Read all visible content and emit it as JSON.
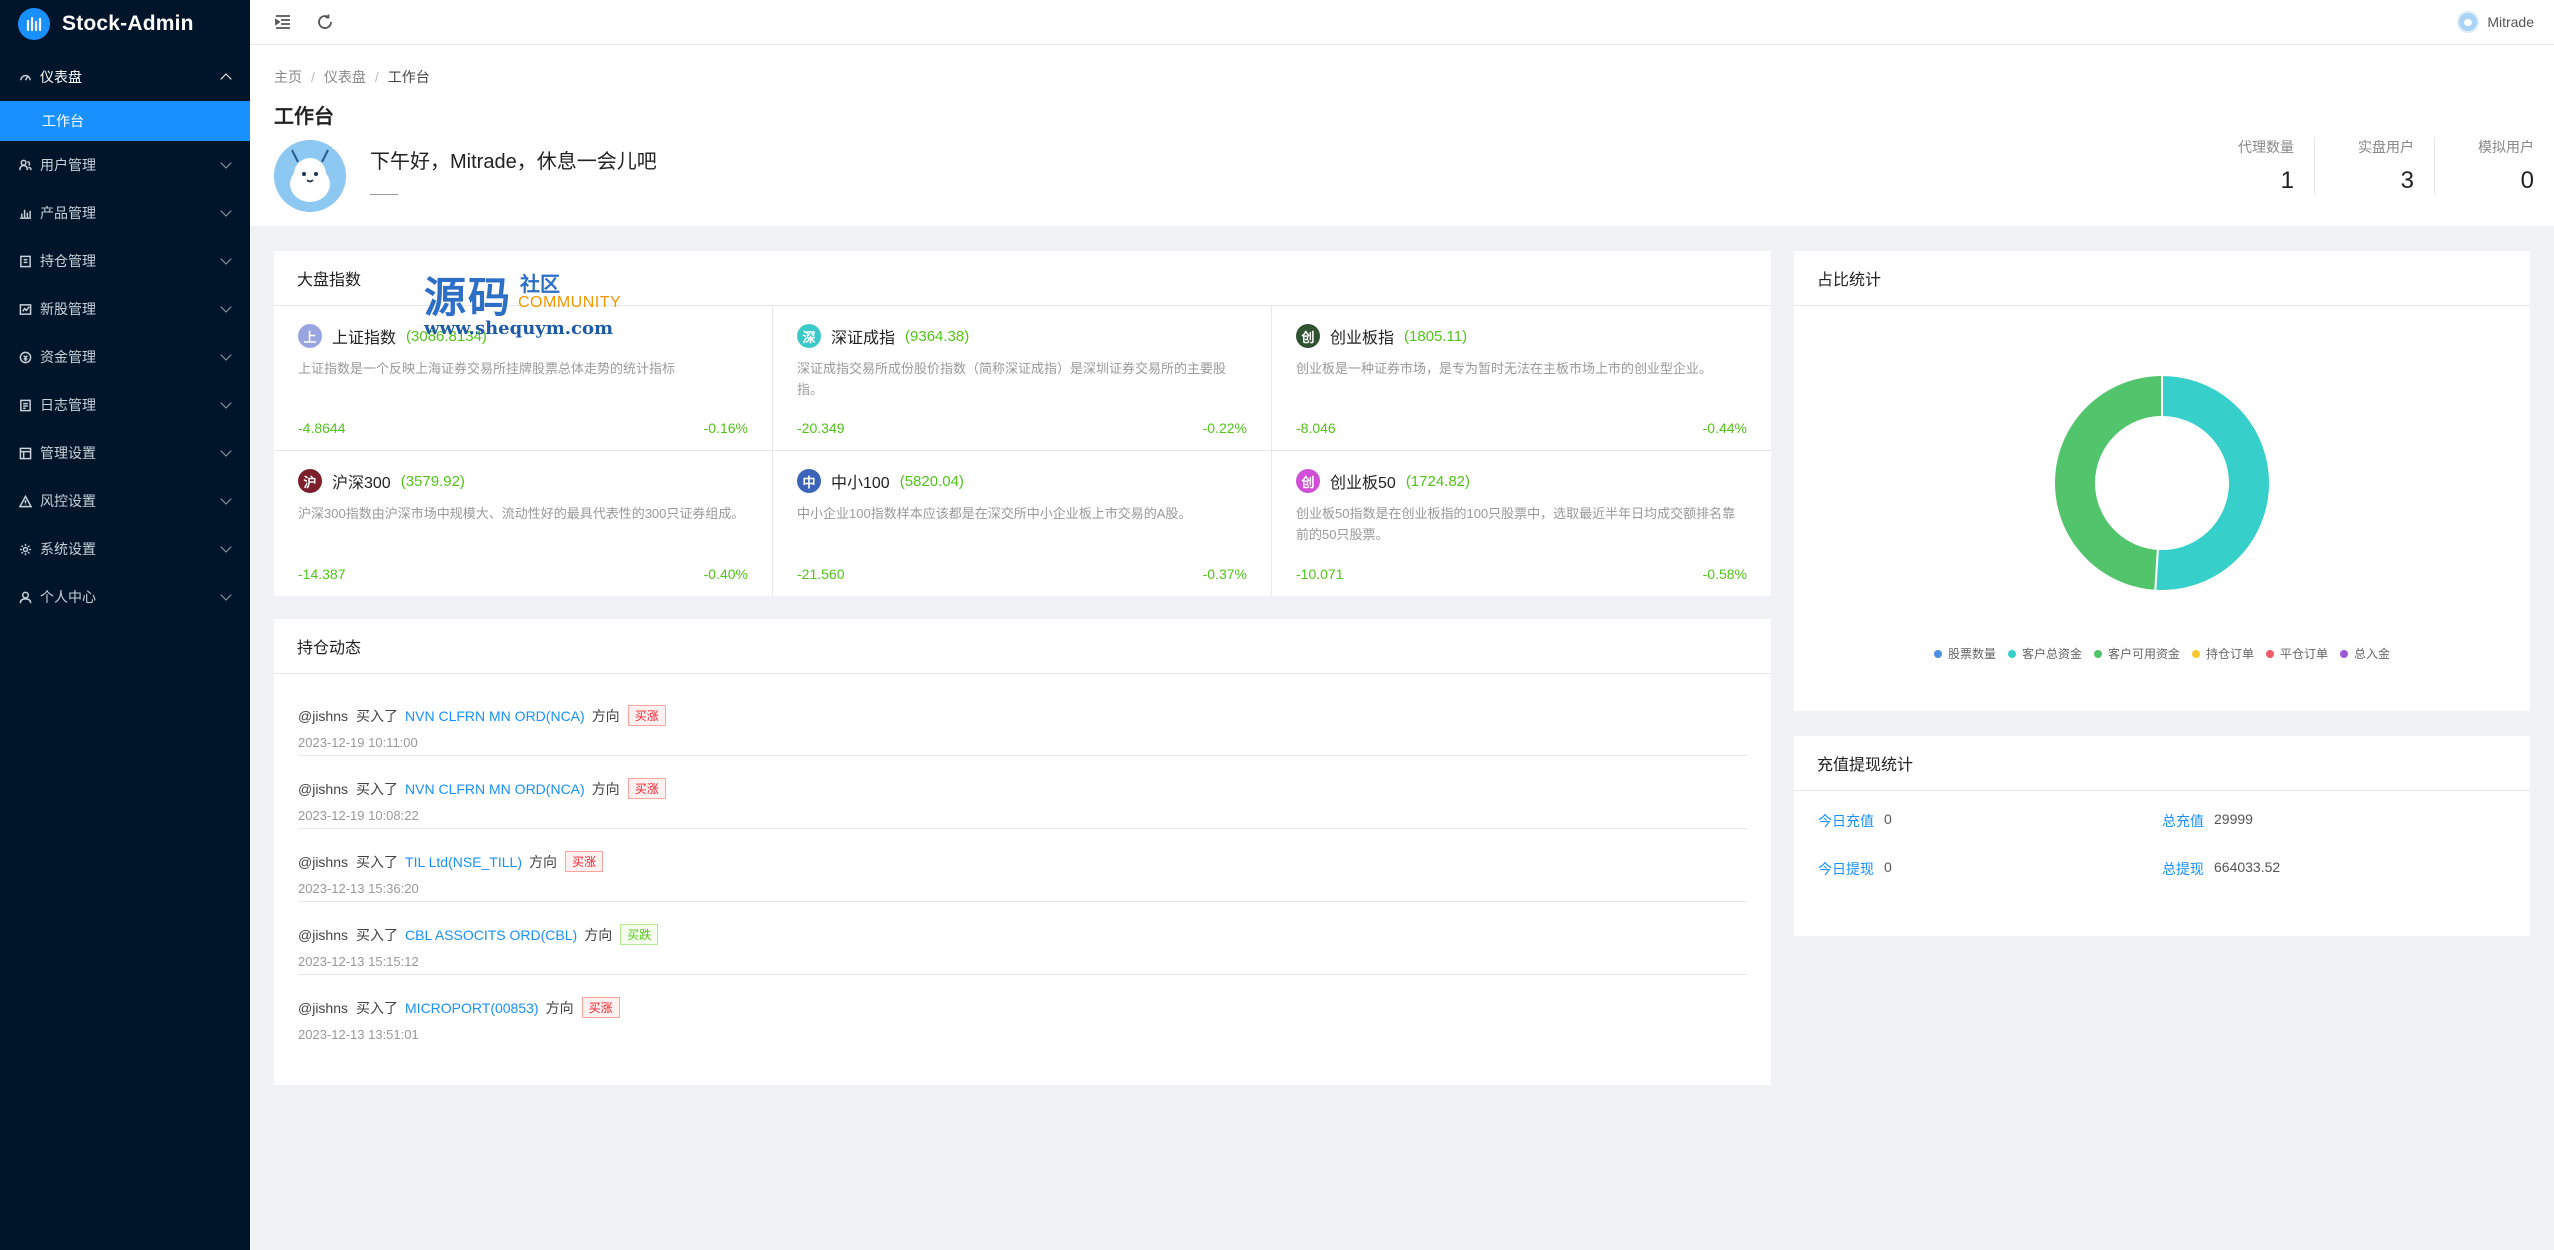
{
  "app": {
    "title": "Stock-Admin"
  },
  "sidebar": {
    "items": [
      {
        "label": "仪表盘",
        "icon": "dashboard-icon",
        "open": true
      },
      {
        "label": "用户管理",
        "icon": "users-icon"
      },
      {
        "label": "产品管理",
        "icon": "bar-chart-icon"
      },
      {
        "label": "持仓管理",
        "icon": "position-icon"
      },
      {
        "label": "新股管理",
        "icon": "new-stock-icon"
      },
      {
        "label": "资金管理",
        "icon": "money-icon"
      },
      {
        "label": "日志管理",
        "icon": "log-icon"
      },
      {
        "label": "管理设置",
        "icon": "admin-settings-icon"
      },
      {
        "label": "风控设置",
        "icon": "warning-icon"
      },
      {
        "label": "系统设置",
        "icon": "gear-icon"
      },
      {
        "label": "个人中心",
        "icon": "user-icon"
      }
    ],
    "active_sub": "工作台"
  },
  "header": {
    "user_name": "Mitrade"
  },
  "breadcrumb": [
    "主页",
    "仪表盘",
    "工作台"
  ],
  "page": {
    "title": "工作台",
    "greeting": "下午好，Mitrade，休息一会儿吧"
  },
  "stats": [
    {
      "label": "代理数量",
      "value": "1"
    },
    {
      "label": "实盘用户",
      "value": "3"
    },
    {
      "label": "模拟用户",
      "value": "0"
    }
  ],
  "market": {
    "title": "大盘指数",
    "indices": [
      {
        "badge": "上",
        "color": "#9aa4e0",
        "name": "上证指数",
        "value": "(3086.8134)",
        "desc": "上证指数是一个反映上海证券交易所挂牌股票总体走势的统计指标",
        "change": "-4.8644",
        "pct": "-0.16%"
      },
      {
        "badge": "深",
        "color": "#3ec9c9",
        "name": "深证成指",
        "value": "(9364.38)",
        "desc": "深证成指交易所成份股价指数（简称深证成指）是深圳证券交易所的主要股指。",
        "change": "-20.349",
        "pct": "-0.22%"
      },
      {
        "badge": "创",
        "color": "#2f5233",
        "name": "创业板指",
        "value": "(1805.11)",
        "desc": "创业板是一种证券市场，是专为暂时无法在主板市场上市的创业型企业。",
        "change": "-8.046",
        "pct": "-0.44%"
      },
      {
        "badge": "沪",
        "color": "#7a1f2b",
        "name": "沪深300",
        "value": "(3579.92)",
        "desc": "沪深300指数由沪深市场中规模大、流动性好的最具代表性的300只证券组成。",
        "change": "-14.387",
        "pct": "-0.40%"
      },
      {
        "badge": "中",
        "color": "#3b63b7",
        "name": "中小100",
        "value": "(5820.04)",
        "desc": "中小企业100指数样本应该都是在深交所中小企业板上市交易的A股。",
        "change": "-21.560",
        "pct": "-0.37%"
      },
      {
        "badge": "创",
        "color": "#d04fd6",
        "name": "创业板50",
        "value": "(1724.82)",
        "desc": "创业板50指数是在创业板指的100只股票中，选取最近半年日均成交额排名靠前的50只股票。",
        "change": "-10.071",
        "pct": "-0.58%"
      }
    ]
  },
  "watermark": {
    "big": "源码",
    "sq": "社区",
    "community": "COMMUNITY",
    "url": "www.shequym.com"
  },
  "positions": {
    "title": "持仓动态",
    "items": [
      {
        "user": "@jishns",
        "action": "买入了",
        "stock": "NVN CLFRN MN ORD(NCA)",
        "dir": "方向",
        "tag": "买涨",
        "tag_type": "red",
        "time": "2023-12-19 10:11:00"
      },
      {
        "user": "@jishns",
        "action": "买入了",
        "stock": "NVN CLFRN MN ORD(NCA)",
        "dir": "方向",
        "tag": "买涨",
        "tag_type": "red",
        "time": "2023-12-19 10:08:22"
      },
      {
        "user": "@jishns",
        "action": "买入了",
        "stock": "TIL Ltd(NSE_TILL)",
        "dir": "方向",
        "tag": "买涨",
        "tag_type": "red",
        "time": "2023-12-13 15:36:20"
      },
      {
        "user": "@jishns",
        "action": "买入了",
        "stock": "CBL ASSOCITS ORD(CBL)",
        "dir": "方向",
        "tag": "买跌",
        "tag_type": "green",
        "time": "2023-12-13 15:15:12"
      },
      {
        "user": "@jishns",
        "action": "买入了",
        "stock": "MICROPORT(00853)",
        "dir": "方向",
        "tag": "买涨",
        "tag_type": "red",
        "time": "2023-12-13 13:51:01"
      }
    ]
  },
  "ratio": {
    "title": "占比统计",
    "legend": [
      {
        "label": "股票数量",
        "color": "#4a90e2"
      },
      {
        "label": "客户总资金",
        "color": "#36cfc9"
      },
      {
        "label": "客户可用资金",
        "color": "#52c46b"
      },
      {
        "label": "持仓订单",
        "color": "#f7c830"
      },
      {
        "label": "平仓订单",
        "color": "#f25a6a"
      },
      {
        "label": "总入金",
        "color": "#9b59d6"
      }
    ]
  },
  "chart_data": {
    "type": "pie",
    "title": "占比统计",
    "labels": [
      "股票数量",
      "客户总资金",
      "客户可用资金",
      "持仓订单",
      "平仓订单",
      "总入金"
    ],
    "values": [
      0,
      51,
      49,
      0,
      0,
      0
    ],
    "colors": [
      "#4a90e2",
      "#36cfc9",
      "#52c46b",
      "#f7c830",
      "#f25a6a",
      "#9b59d6"
    ],
    "donut": true,
    "legend": "bottom"
  },
  "finance": {
    "title": "充值提现统计",
    "items": [
      {
        "label": "今日充值",
        "value": "0"
      },
      {
        "label": "总充值",
        "value": "29999"
      },
      {
        "label": "今日提现",
        "value": "0"
      },
      {
        "label": "总提现",
        "value": "664033.52"
      }
    ]
  }
}
